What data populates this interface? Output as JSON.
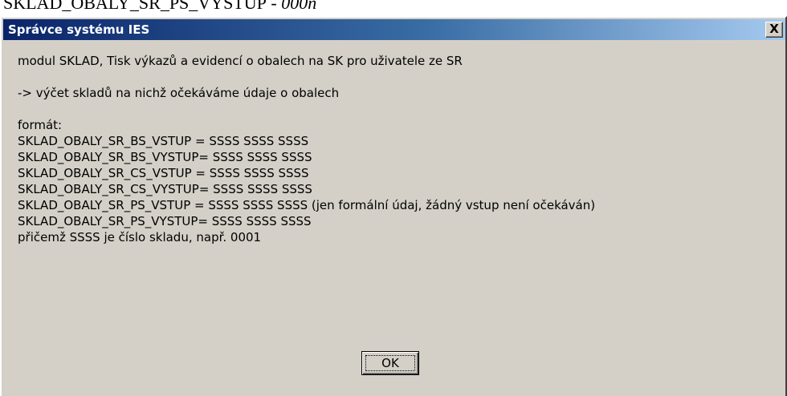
{
  "background_caption": {
    "text": "SKLAD_OBALY_SR_PS_VYSTUP",
    "suffix": " - 000n"
  },
  "dialog": {
    "title": "Správce systému IES",
    "close_label": "X",
    "message_lines": [
      "modul SKLAD, Tisk výkazů a evidencí o obalech na SK pro uživatele ze SR",
      "",
      "-> výčet skladů na nichž očekáváme údaje o obalech",
      "",
      "formát:",
      "SKLAD_OBALY_SR_BS_VSTUP = SSSS SSSS SSSS",
      "SKLAD_OBALY_SR_BS_VYSTUP= SSSS SSSS SSSS",
      "SKLAD_OBALY_SR_CS_VSTUP = SSSS SSSS SSSS",
      "SKLAD_OBALY_SR_CS_VYSTUP= SSSS SSSS SSSS",
      "SKLAD_OBALY_SR_PS_VSTUP = SSSS SSSS SSSS  (jen formální údaj, žádný vstup není očekáván)",
      "SKLAD_OBALY_SR_PS_VYSTUP= SSSS SSSS SSSS",
      "přičemž SSSS je číslo skladu, např. 0001"
    ],
    "ok_label": "OK"
  },
  "colors": {
    "face": "#d4d0c8",
    "title_start": "#0a246a",
    "title_end": "#a6caf0"
  },
  "icons": {
    "close": "close-icon"
  }
}
